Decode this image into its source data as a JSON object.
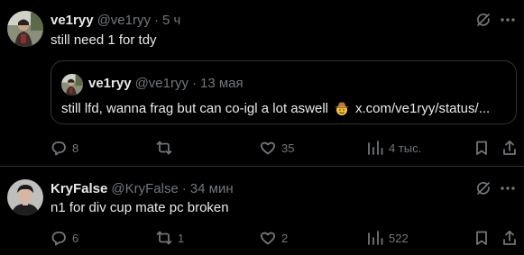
{
  "tweets": [
    {
      "display_name": "ve1ryy",
      "handle": "@ve1ryy",
      "separator": "·",
      "time": "5 ч",
      "text": "still need 1 for tdy",
      "quote": {
        "display_name": "ve1ryy",
        "handle": "@ve1ryy",
        "separator": "·",
        "time": "13 мая",
        "text": "still lfd, wanna frag but can co-igl a lot aswell",
        "emoji": "cowboy-hat-face",
        "link": "x.com/ve1ryy/status/..."
      },
      "actions": {
        "replies": "8",
        "retweets": "",
        "likes": "35",
        "views": "4 тыс."
      }
    },
    {
      "display_name": "KryFalse",
      "handle": "@KryFalse",
      "separator": "·",
      "time": "34 мин",
      "text": "n1 for div cup mate pc broken",
      "actions": {
        "replies": "6",
        "retweets": "1",
        "likes": "2",
        "views": "522"
      }
    }
  ],
  "icons": {
    "grok": "grok-icon",
    "more": "more-dots-icon",
    "reply": "reply-icon",
    "retweet": "retweet-icon",
    "like": "heart-icon",
    "views": "views-chart-icon",
    "bookmark": "bookmark-icon",
    "share": "share-icon"
  },
  "colors": {
    "background": "#000000",
    "text": "#e7e9ea",
    "secondary": "#71767b",
    "border": "#2f3336"
  }
}
